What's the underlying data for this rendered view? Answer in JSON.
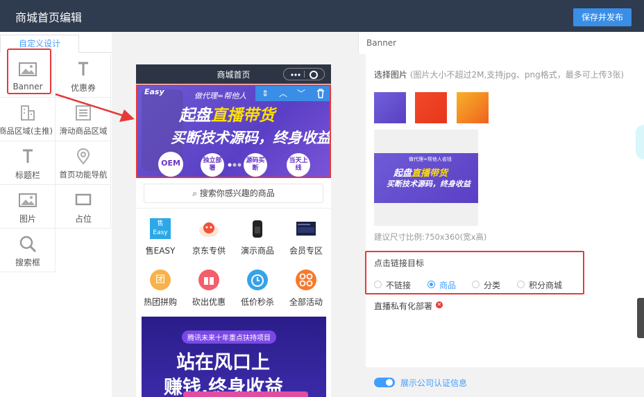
{
  "header": {
    "title": "商城首页编辑",
    "publish_label": "保存并发布"
  },
  "left_panel": {
    "tab_label": "自定义设计",
    "components": [
      {
        "label": "Banner",
        "icon": "image-icon"
      },
      {
        "label": "优惠券",
        "icon": "text-icon"
      },
      {
        "label": "商品区域(主推)",
        "icon": "building-icon"
      },
      {
        "label": "滑动商品区域",
        "icon": "list-icon"
      },
      {
        "label": "标题栏",
        "icon": "text-icon"
      },
      {
        "label": "首页功能导航",
        "icon": "location-icon"
      },
      {
        "label": "图片",
        "icon": "image-icon"
      },
      {
        "label": "占位",
        "icon": "placeholder-icon"
      },
      {
        "label": "搜索框",
        "icon": "search-icon"
      }
    ]
  },
  "phone": {
    "title": "商城首页",
    "banner": {
      "logo": "Easy",
      "slogan": "做代理=帮他人",
      "line1_a": "起盘",
      "line1_b": "直播带货",
      "line2": "买断技术源码，终身收益",
      "oem": "OEM",
      "bubbles": [
        "独立部署",
        "源码买断",
        "当天上线"
      ]
    },
    "search_placeholder": "搜索你感兴趣的商品",
    "icons_row1": [
      {
        "label": "售EASY",
        "icon_text": "售Easy"
      },
      {
        "label": "京东专供",
        "icon_text": ""
      },
      {
        "label": "演示商品",
        "icon_text": ""
      },
      {
        "label": "会员专区",
        "icon_text": ""
      }
    ],
    "icons_row2": [
      {
        "label": "热团拼购",
        "icon_text": "团"
      },
      {
        "label": "砍出优惠",
        "icon_text": ""
      },
      {
        "label": "低价秒杀",
        "icon_text": ""
      },
      {
        "label": "全部活动",
        "icon_text": ""
      }
    ],
    "promo": {
      "tag": "腾讯未来十年重点扶持项目",
      "line1": "站在风口上",
      "line2": "赚钱,终身收益"
    }
  },
  "right_panel": {
    "header": "Banner",
    "select_label": "选择图片",
    "select_hint": "(图片大小不超过2M,支持jpg、png格式，最多可上传3张)",
    "preview": {
      "slogan": "做代理=帮他人省钱",
      "line1_a": "起盘",
      "line1_b": "直播带货",
      "line2": "买断技术源码，终身收益"
    },
    "suggest_size": "建议尺寸比例:750x360(宽x高)",
    "link_title": "点击链接目标",
    "link_options": [
      "不链接",
      "商品",
      "分类",
      "积分商城"
    ],
    "link_selected": "商品",
    "live_label": "直播私有化部署",
    "toggle_label": "展示公司认证信息"
  },
  "colors": {
    "accent": "#409eff",
    "header_bg": "#2f3b4f",
    "highlight": "#e5393a"
  }
}
